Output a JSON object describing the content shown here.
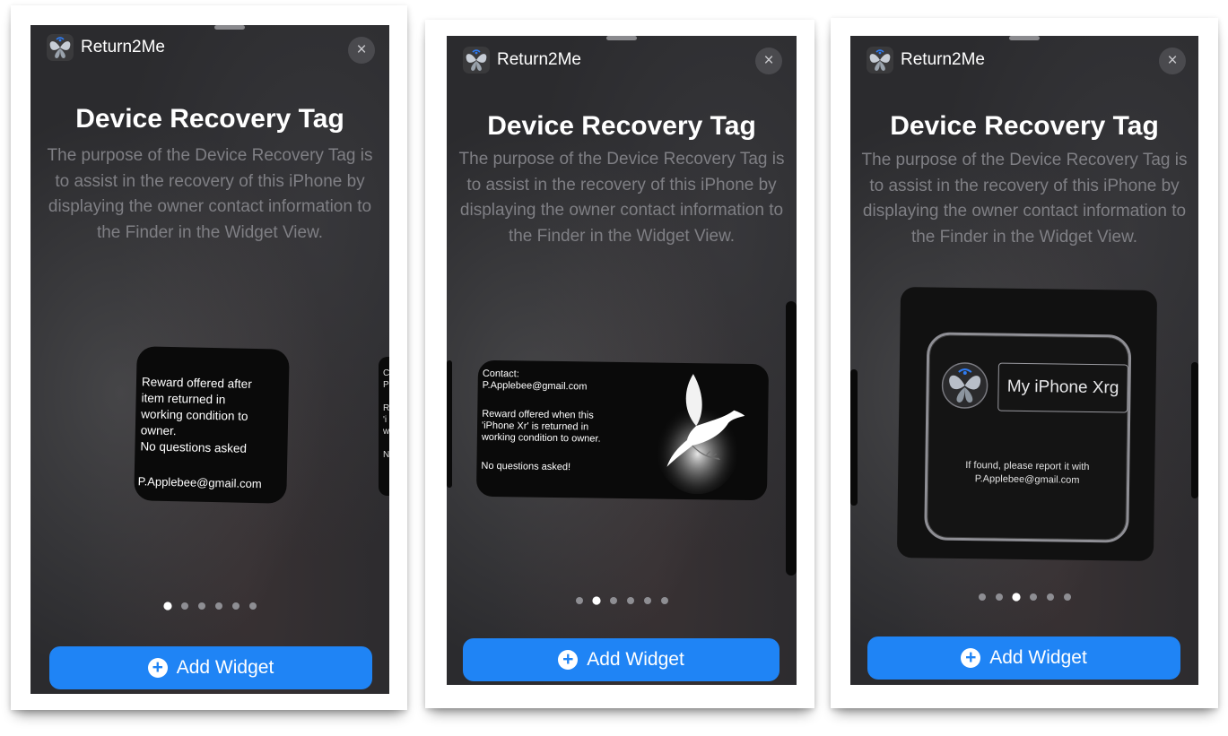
{
  "screens": [
    {
      "app_name": "Return2Me",
      "close_glyph": "×",
      "title": "Device Recovery Tag",
      "description": "The purpose of the Device Recovery Tag is to assist in the recovery of this iPhone by displaying the owner contact information to the Finder in the Widget View.",
      "page_count": 6,
      "active_page": 1,
      "widget": {
        "lines": [
          "Reward offered after",
          "item returned in",
          "working condition to",
          "owner.",
          "No questions asked"
        ],
        "email": "P.Applebee@gmail.com"
      },
      "next_peek": [
        "C",
        "P",
        "",
        "R",
        "'i",
        "w",
        "",
        "N"
      ],
      "add_label": "Add Widget"
    },
    {
      "app_name": "Return2Me",
      "close_glyph": "×",
      "title": "Device Recovery Tag",
      "description": "The purpose of the Device Recovery Tag is to assist in the recovery of this iPhone by displaying the owner contact information to the Finder in the Widget View.",
      "page_count": 6,
      "active_page": 2,
      "widget": {
        "contact_label": "Contact:",
        "email": "P.Applebee@gmail.com",
        "reward_lines": [
          "Reward offered when this",
          "'iPhone Xr' is returned in",
          "working condition to owner."
        ],
        "no_questions": "No questions asked!",
        "image": "dove-icon"
      },
      "add_label": "Add Widget"
    },
    {
      "app_name": "Return2Me",
      "close_glyph": "×",
      "title": "Device Recovery Tag",
      "description": "The purpose of the Device Recovery Tag is to assist in the recovery of this iPhone by displaying the owner contact information to the Finder in the Widget View.",
      "page_count": 6,
      "active_page": 3,
      "widget": {
        "device_name": "My iPhone Xrg",
        "found_lines": [
          "If found, please report it with",
          "P.Applebee@gmail.com"
        ]
      },
      "add_label": "Add Widget"
    }
  ],
  "colors": {
    "accent": "#1f84f5",
    "sheet_bg": "#2b2b2e",
    "description": "#7f7f84"
  }
}
